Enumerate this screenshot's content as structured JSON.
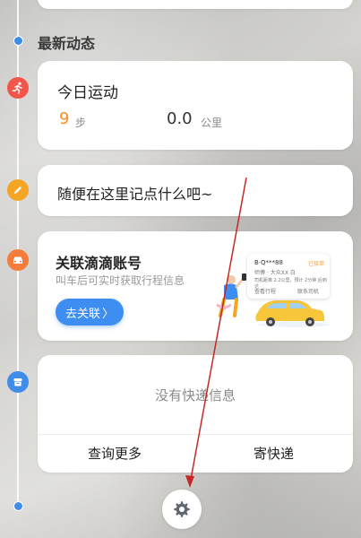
{
  "section": {
    "title": "最新动态"
  },
  "exercise": {
    "title": "今日运动",
    "steps": "9",
    "steps_unit": "步",
    "distance": "0.0",
    "distance_unit": "公里",
    "icon": "running-icon",
    "icon_color": "#f2564a"
  },
  "note": {
    "text": "随便在这里记点什么吧~",
    "icon": "pencil-icon",
    "icon_color": "#f5a524"
  },
  "didi": {
    "title": "关联滴滴账号",
    "subtitle": "叫车后可实时获取行程信息",
    "button_label": "去关联",
    "button_chevron": "〉",
    "icon": "car-icon",
    "icon_color": "#f57b3a",
    "preview": {
      "plate": "B·Q***88",
      "status": "已接单",
      "line2": "师傅 · 大众XX 白",
      "line3": "司机距离 2.2公里，预计 2分钟 后到达",
      "action1": "查看行程",
      "action2": "联系司机"
    }
  },
  "express": {
    "empty_text": "没有快递信息",
    "query_more": "查询更多",
    "send": "寄快递",
    "icon": "package-icon",
    "icon_color": "#3f8de8"
  },
  "settings": {
    "icon": "gear-icon"
  },
  "colors": {
    "accent": "#3d8ef0",
    "steps": "#ff8a1f",
    "annotation_arrow": "#c62828"
  }
}
